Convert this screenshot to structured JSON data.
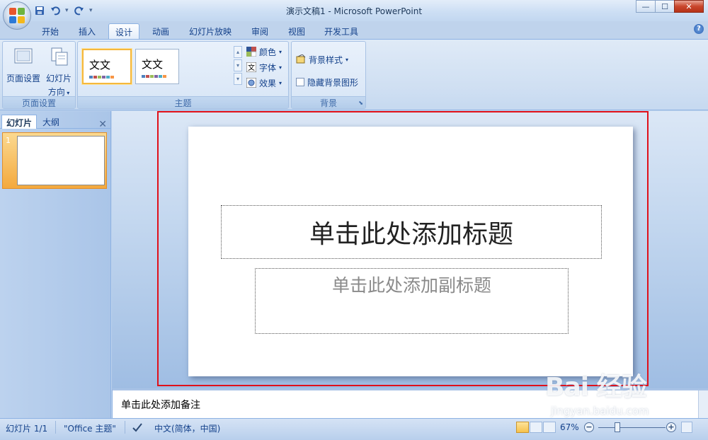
{
  "window": {
    "title": "演示文稿1 - Microsoft PowerPoint",
    "controls": [
      "—",
      "☐",
      "✕"
    ]
  },
  "quick_access": {
    "icons": [
      "save-icon",
      "undo-icon",
      "redo-icon",
      "customize-icon"
    ]
  },
  "tabs": [
    {
      "label": "开始"
    },
    {
      "label": "插入"
    },
    {
      "label": "设计",
      "active": true
    },
    {
      "label": "动画"
    },
    {
      "label": "幻灯片放映"
    },
    {
      "label": "审阅"
    },
    {
      "label": "视图"
    },
    {
      "label": "开发工具"
    }
  ],
  "ribbon": {
    "page_setup": {
      "group_label": "页面设置",
      "page_setup_label": "页面设置",
      "orientation_label_1": "幻灯片",
      "orientation_label_2": "方向"
    },
    "themes": {
      "group_label": "主题",
      "thumb_1": "文文",
      "thumb_2": "文文",
      "colors": "颜色",
      "fonts": "字体",
      "effects": "效果"
    },
    "background": {
      "group_label": "背景",
      "styles": "背景样式",
      "hide_graphics": "隐藏背景图形"
    }
  },
  "left_pane": {
    "tab_slides": "幻灯片",
    "tab_outline": "大纲",
    "close": "✕",
    "slide_number": "1"
  },
  "slide": {
    "title_placeholder": "单击此处添加标题",
    "subtitle_placeholder": "单击此处添加副标题"
  },
  "notes": {
    "placeholder": "单击此处添加备注"
  },
  "watermark": {
    "main": "Bai 经验",
    "sub": "jingyan.baidu.com"
  },
  "status": {
    "slide_count": "幻灯片 1/1",
    "theme": "\"Office 主题\"",
    "language": "中文(简体，中国)",
    "zoom": "67%"
  },
  "colors": {
    "accent_red": "#e0101a",
    "ribbon_text": "#15428b",
    "selection_orange": "#f4a93d"
  }
}
